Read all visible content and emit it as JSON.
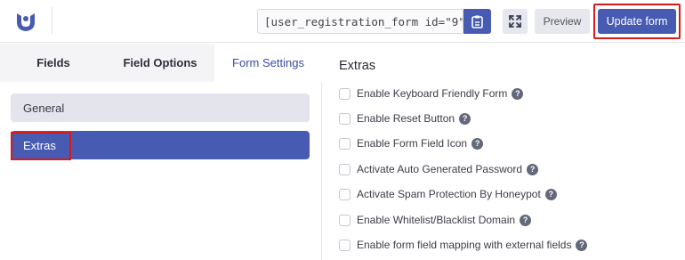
{
  "header": {
    "logo": "user-registration-logo",
    "shortcode": "[user_registration_form id=\"9\"]",
    "copy_icon": "clipboard-icon",
    "expand_icon": "fullscreen-icon",
    "preview_label": "Preview",
    "update_label": "Update form",
    "accent_color": "#475bb2",
    "highlight_color": "#d81a1a"
  },
  "tabs": [
    {
      "label": "Fields",
      "active": false
    },
    {
      "label": "Field Options",
      "active": false
    },
    {
      "label": "Form Settings",
      "active": true
    }
  ],
  "settings_nav": [
    {
      "label": "General",
      "active": false
    },
    {
      "label": "Extras",
      "active": true
    }
  ],
  "extras": {
    "title": "Extras",
    "options": [
      {
        "label": "Enable Keyboard Friendly Form",
        "checked": false
      },
      {
        "label": "Enable Reset Button",
        "checked": false
      },
      {
        "label": "Enable Form Field Icon",
        "checked": false
      },
      {
        "label": "Activate Auto Generated Password",
        "checked": false
      },
      {
        "label": "Activate Spam Protection By Honeypot",
        "checked": false
      },
      {
        "label": "Enable Whitelist/Blacklist Domain",
        "checked": false
      },
      {
        "label": "Enable form field mapping with external fields",
        "checked": false
      }
    ],
    "help_glyph": "?"
  }
}
